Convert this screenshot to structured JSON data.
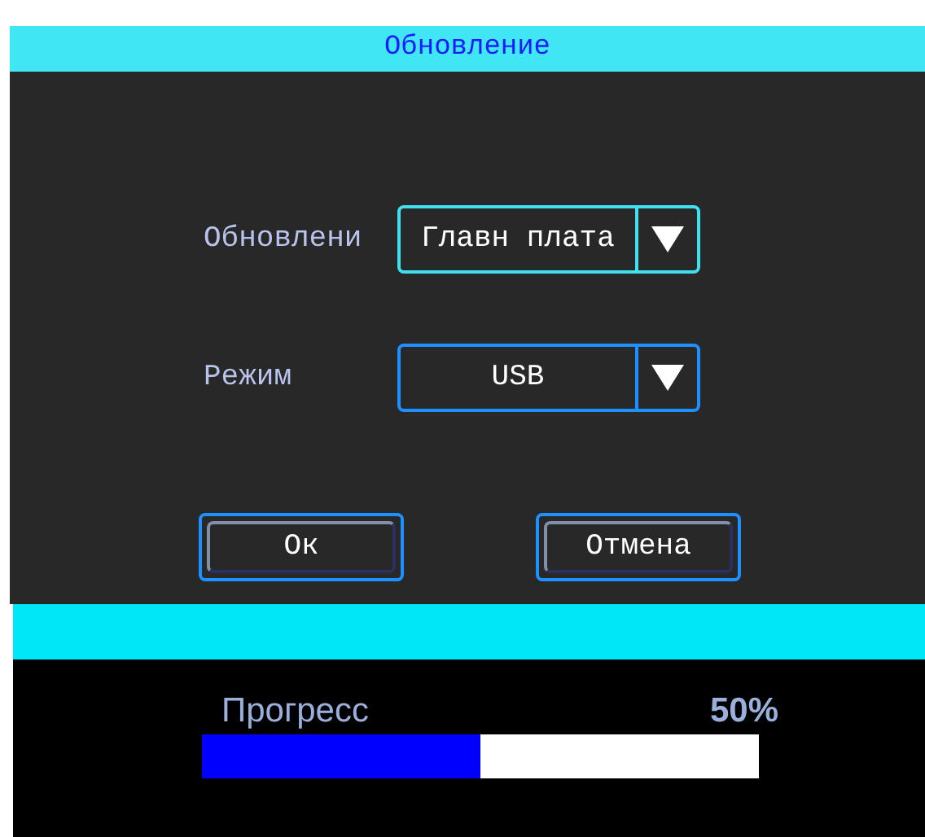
{
  "dialog": {
    "title": "Обновление",
    "fields": [
      {
        "label": "Обновлени",
        "value": "Главн плата",
        "focused": true
      },
      {
        "label": "Режим",
        "value": "USB",
        "focused": false
      }
    ],
    "buttons": [
      "Ок",
      "Отмена"
    ]
  },
  "progress": {
    "label": "Прогресс",
    "reading": "50%",
    "level": 0.5
  }
}
